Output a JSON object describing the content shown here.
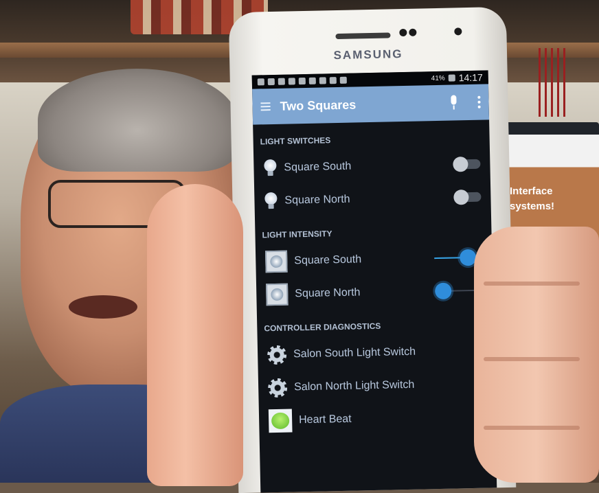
{
  "phone": {
    "brand": "SAMSUNG",
    "status_bar": {
      "battery": "41%",
      "time": "14:17"
    },
    "app_bar": {
      "title": "Two Squares",
      "icons": [
        "menu-icon",
        "mic-icon",
        "overflow-menu-icon"
      ]
    },
    "sections": {
      "light_switches": {
        "header": "LIGHT SWITCHES",
        "items": [
          {
            "label": "Square South",
            "icon": "bulb-icon",
            "state": "off"
          },
          {
            "label": "Square North",
            "icon": "bulb-icon",
            "state": "off"
          }
        ]
      },
      "light_intensity": {
        "header": "LIGHT INTENSITY",
        "items": [
          {
            "label": "Square South",
            "icon": "dimmer-icon",
            "level": 0.7
          },
          {
            "label": "Square North",
            "icon": "dimmer-icon",
            "level": 0.0
          }
        ]
      },
      "controller_diagnostics": {
        "header": "CONTROLLER DIAGNOSTICS",
        "items": [
          {
            "label": "Salon South Light Switch",
            "icon": "gear-icon"
          },
          {
            "label": "Salon North Light Switch",
            "icon": "gear-icon"
          },
          {
            "label": "Heart Beat",
            "icon": "smiley-icon"
          }
        ]
      }
    },
    "colors": {
      "app_bar": "#7fa6d2",
      "screen_background": "#101318",
      "accent": "#2f8ddb"
    }
  },
  "background_monitor": {
    "text_line_1": "Interface",
    "text_line_2": "systems!"
  }
}
